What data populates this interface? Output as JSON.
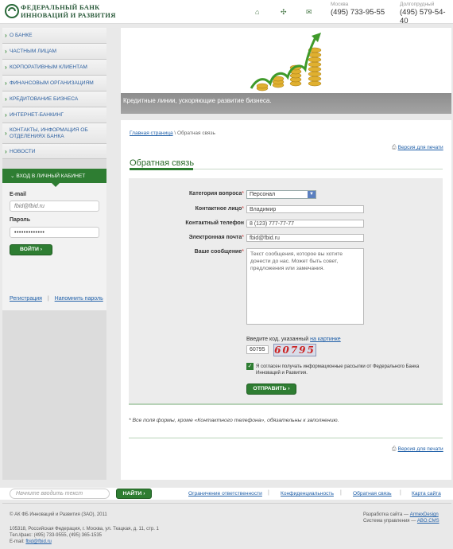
{
  "header": {
    "logo_line1": "ФЕДЕРАЛЬНЫЙ БАНК",
    "logo_line2": "ИННОВАЦИЙ И РАЗВИТИЯ",
    "icons": [
      "home-icon",
      "sitemap-icon",
      "mail-icon"
    ],
    "phones": [
      {
        "city": "Москва",
        "number": "(495) 733-95-55"
      },
      {
        "city": "Долгопрудный",
        "number": "(495) 579-54-40"
      }
    ]
  },
  "nav": [
    "О БАНКЕ",
    "ЧАСТНЫМ ЛИЦАМ",
    "КОРПОРАТИВНЫМ КЛИЕНТАМ",
    "ФИНАНСОВЫМ ОРГАНИЗАЦИЯМ",
    "КРЕДИТОВАНИЕ БИЗНЕСА",
    "ИНТЕРНЕТ-БАНКИНГ",
    "КОНТАКТЫ, ИНФОРМАЦИЯ ОБ ОТДЕЛЕНИЯХ БАНКА",
    "НОВОСТИ"
  ],
  "login": {
    "title": "ВХОД В ЛИЧНЫЙ КАБИНЕТ",
    "email_label": "E-mail",
    "email_value": "fbid@fbid.ru",
    "password_label": "Пароль",
    "password_value": "•••••••••••••",
    "submit": "ВОЙТИ",
    "register": "Регистрация",
    "separator": "|",
    "remind": "Напомнить пароль"
  },
  "banner": {
    "caption": "Кредитные линии, ускоряющие развитие бизнеса."
  },
  "page": {
    "breadcrumb_home": "Главная страница",
    "breadcrumb_sep": "\\",
    "breadcrumb_current": "Обратная связь",
    "print_label": "Версия для печати",
    "title": "Обратная связь"
  },
  "form": {
    "category_label": "Категория вопроса",
    "category_value": "Персонал",
    "contact_label": "Контактное лицо",
    "contact_value": "Владимир",
    "phone_label": "Контактный телефон",
    "phone_value": "8 (123) 777-77-77",
    "email_label": "Электронная почта",
    "email_value": "fbid@fbid.ru",
    "message_label": "Ваше сообщение",
    "message_value": "Текст сообщения, которое вы хотите донести до нас. Может быть совет, предложения или замечания.",
    "required_mark": "*",
    "captcha_label": "Введите код, указанный",
    "captcha_link": "на картинке",
    "captcha_value": "60795",
    "captcha_image_text": "60795",
    "agree_text": "Я согласен получать информационные рассылки от Федерального Банка Инноваций и Развития.",
    "submit": "ОТПРАВИТЬ"
  },
  "note": "* Все поля формы, кроме «Контактного телефона», обязательны к заполнению.",
  "footer": {
    "search_placeholder": "Начните вводить текст",
    "search_button": "НАЙТИ",
    "links": [
      "Ограничение ответственности",
      "Конфиденциальность",
      "Обратная связь",
      "Карта сайта"
    ],
    "copyright": "© АК ФБ Инноваций и Развития (ЗАО), 2011",
    "address": "105318, Российская Федерация, г. Москва, ул. Ткацкая, д. 11, стр. 1",
    "phones": "Тел./факс: (495) 733-9555, (495) 365-1535",
    "email_label": "E-mail:",
    "email": "fbid@fbid.ru",
    "dev_label": "Разработка сайта —",
    "dev_name": "ArmexDesign",
    "cms_label": "Система управления —",
    "cms_name": "ABO.CMS"
  },
  "colors": {
    "accent": "#2e7d32",
    "link": "#1f5fa8"
  }
}
